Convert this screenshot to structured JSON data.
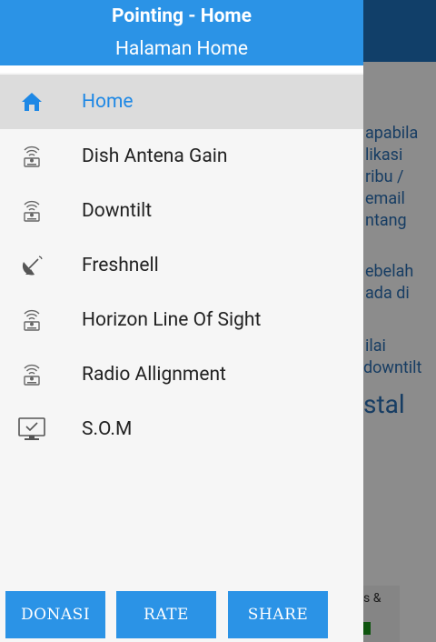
{
  "drawer": {
    "header": {
      "title": "Pointing - Home",
      "subtitle": "Halaman Home"
    },
    "items": [
      {
        "label": "Home",
        "icon": "home-icon",
        "active": true
      },
      {
        "label": "Dish Antena Gain",
        "icon": "radio-antenna-icon"
      },
      {
        "label": "Downtilt",
        "icon": "radio-antenna-icon"
      },
      {
        "label": "Freshnell",
        "icon": "satellite-dish-icon"
      },
      {
        "label": "Horizon Line Of Sight",
        "icon": "radio-antenna-icon"
      },
      {
        "label": "Radio Allignment",
        "icon": "radio-antenna-icon"
      },
      {
        "label": "S.O.M",
        "icon": "monitor-check-icon"
      }
    ],
    "buttons": {
      "donasi": "DONASI",
      "rate": "RATE",
      "share": "SHARE"
    }
  },
  "background": {
    "lines": [
      "apabila",
      "likasi",
      "ribu /",
      "email",
      "ntang",
      "ebelah",
      "ada di",
      "ilai",
      "downtilt"
    ],
    "title": "stal",
    "footer_text": "s &"
  },
  "colors": {
    "accent": "#2b93e6",
    "active_text": "#1e88e5",
    "toolbar": "#1f74bf"
  }
}
